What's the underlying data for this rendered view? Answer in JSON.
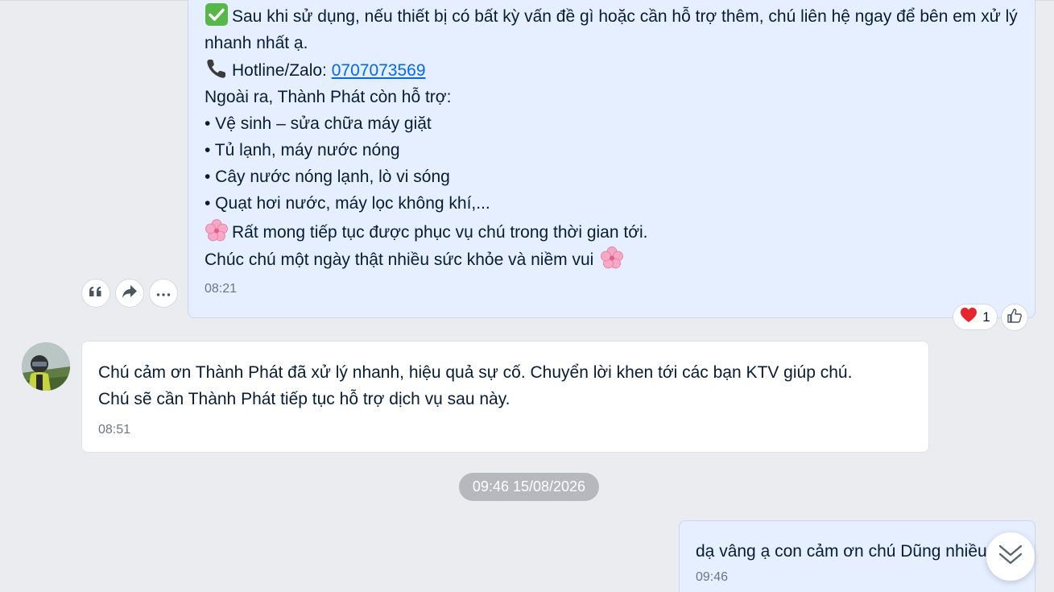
{
  "messages": {
    "outgoing_long": {
      "line1": "Sau khi sử dụng, nếu thiết bị có bất kỳ vấn đề gì hoặc cần hỗ trợ thêm, chú liên hệ ngay để bên em xử lý nhanh nhất ạ.",
      "hotline_label": "Hotline/Zalo: ",
      "hotline_number": "0707073569",
      "support_intro": "Ngoài ra, Thành Phát còn hỗ trợ:",
      "support_items": [
        "• Vệ sinh – sửa chữa máy giặt",
        "• Tủ lạnh, máy nước nóng",
        "• Cây nước nóng lạnh, lò vi sóng",
        "• Quạt hơi nước, máy lọc không khí,..."
      ],
      "closing1": "Rất mong tiếp tục được phục vụ chú trong thời gian tới.",
      "closing2": "Chúc chú một ngày thật nhiều sức khỏe và niềm vui",
      "time": "08:21",
      "reaction_count": "1"
    },
    "incoming": {
      "text1": "Chú cảm ơn Thành Phát đã xử lý nhanh, hiệu quả sự cố. Chuyển lời khen tới các bạn KTV giúp chú.",
      "text2": "Chú sẽ cần Thành Phát tiếp tục hỗ trợ dịch vụ sau này.",
      "time": "08:51"
    },
    "date_separator": "09:46 15/08/2026",
    "outgoing_short": {
      "text": "dạ vâng ạ con cảm ơn chú Dũng nhiều",
      "time": "09:46"
    }
  },
  "icons": {
    "check": "check-mark-button-icon",
    "phone": "telephone-receiver-icon",
    "flower": "cherry-blossom-icon",
    "quote": "quote-icon",
    "forward": "forward-icon",
    "more": "more-icon",
    "heart": "heart-icon",
    "like": "thumbs-up-icon",
    "scroll": "chevrons-down-icon"
  },
  "colors": {
    "background": "#ebecf0",
    "outgoing_bubble": "#e5efff",
    "incoming_bubble": "#ffffff",
    "link": "#0068ff"
  }
}
